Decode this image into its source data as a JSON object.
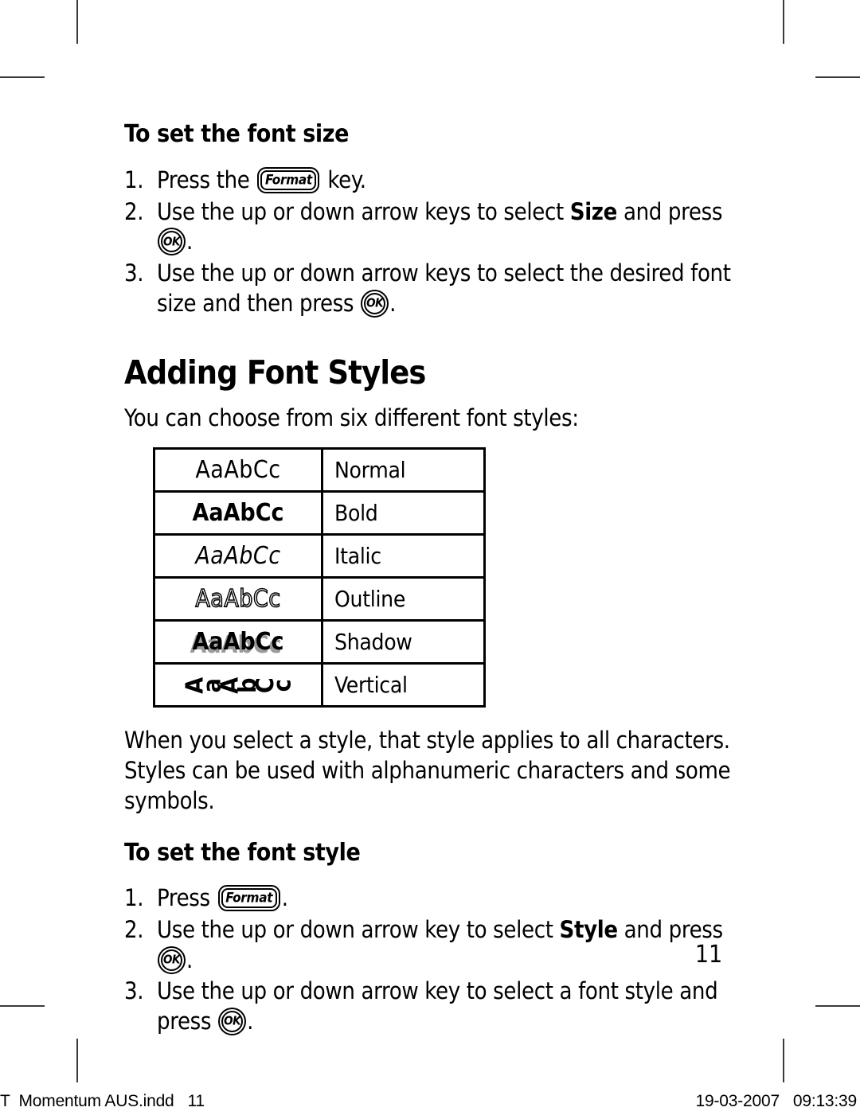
{
  "document": {
    "page_number": "11"
  },
  "section_font_size": {
    "heading": "To set the font size",
    "steps": [
      {
        "num": "1.",
        "before": "Press the",
        "key": "Format",
        "after": "key."
      },
      {
        "num": "2.",
        "before": "Use the up or down arrow keys to select",
        "bold": "Size",
        "mid": "and press",
        "key": "OK",
        "after": "."
      },
      {
        "num": "3.",
        "before": "Use the up or down arrow keys to select the desired font size and then press",
        "key": "OK",
        "after": "."
      }
    ]
  },
  "section_font_styles": {
    "heading": "Adding Font Styles",
    "intro": "You can choose from six different font styles:",
    "sample_text": "AaAbCc",
    "table": {
      "rows": [
        {
          "sample": "AaAbCc",
          "label": "Normal"
        },
        {
          "sample": "AaAbCc",
          "label": "Bold"
        },
        {
          "sample": "AaAbCc",
          "label": "Italic"
        },
        {
          "sample": "AaAbCc",
          "label": "Outline"
        },
        {
          "sample": "AaAbCc",
          "label": "Shadow"
        },
        {
          "sample": "AaAbCc",
          "label": "Vertical"
        }
      ]
    },
    "note": "When you select a style, that style applies to all characters. Styles can be used with alphanumeric characters and some symbols."
  },
  "section_font_style": {
    "heading": "To set the font style",
    "steps": [
      {
        "num": "1.",
        "before": "Press",
        "key": "Format",
        "after": "."
      },
      {
        "num": "2.",
        "before": "Use the up or down arrow key to select",
        "bold": "Style",
        "mid": "and press",
        "key": "OK",
        "after": "."
      },
      {
        "num": "3.",
        "before": "Use the up or down arrow key to select a font style and press",
        "key": "OK",
        "after": "."
      }
    ]
  },
  "keys": {
    "format_label": "Format",
    "ok_label": "OK"
  },
  "print_footer": {
    "file": "T  Momentum AUS.indd   11",
    "timestamp": "19-03-2007   09:13:39"
  }
}
